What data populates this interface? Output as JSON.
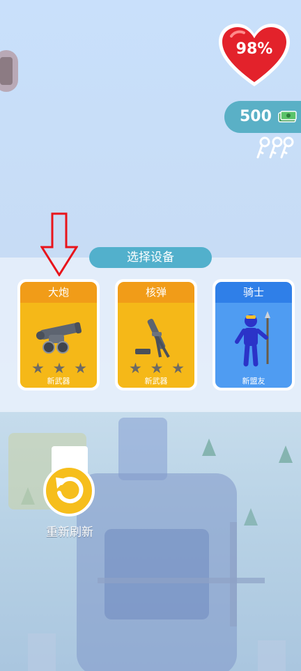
{
  "hud": {
    "health_percent": "98%",
    "money": "500",
    "money_icon": "cash-icon",
    "keys_icon": "keys-icon"
  },
  "panel": {
    "title": "选择设备",
    "cards": [
      {
        "title": "大炮",
        "footer": "新武器",
        "stars": 3,
        "icon": "cannon-icon",
        "color": "#f5b818",
        "header_color": "#f19c18"
      },
      {
        "title": "核弹",
        "footer": "新武器",
        "stars": 3,
        "icon": "mortar-icon",
        "color": "#f5b818",
        "header_color": "#f19c18"
      },
      {
        "title": "骑士",
        "footer": "新盟友",
        "icon": "knight-icon",
        "color": "#4f9cf2",
        "header_color": "#2f7fe8"
      }
    ]
  },
  "refresh": {
    "label": "重新刷新"
  },
  "colors": {
    "heart": "#e3222b",
    "money_bg": "#5ab0c6",
    "title_pill": "#52b0cc",
    "arrow": "#e8141b"
  }
}
